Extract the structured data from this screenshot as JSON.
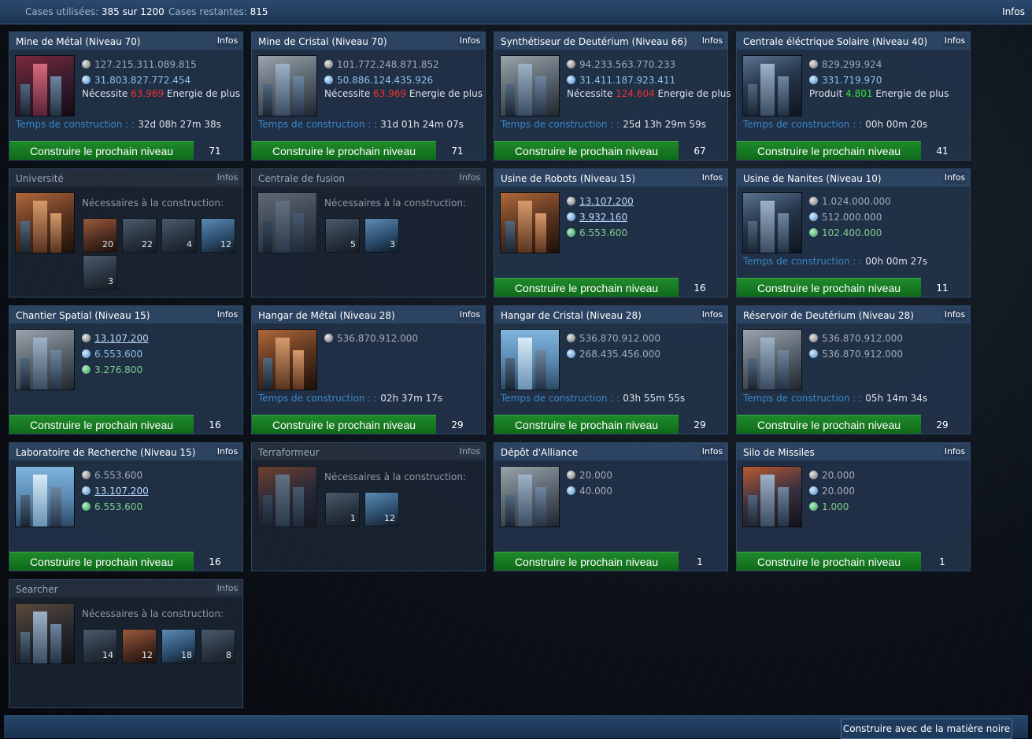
{
  "topbar": {
    "used_label": "Cases utilisées:",
    "used_value": "385 sur 1200",
    "remaining_label": "Cases restantes:",
    "remaining_value": "815",
    "info_label": "Infos"
  },
  "common": {
    "info_button": "Infos",
    "build_button": "Construire le prochain niveau",
    "time_label": "Temps de construction : :",
    "needs_label": "Nécessaires à la construction:",
    "requires_prefix": "Nécessite",
    "produces_prefix": "Produit",
    "energy_suffix": "Energie de plus"
  },
  "cards": {
    "metal_mine": {
      "title": "Mine de Métal (Niveau 70)",
      "metal": "127.215.311.089.815",
      "crystal": "31.803.827.772.454",
      "energy": "63.969",
      "time": "32d 08h 27m 38s",
      "next_level": "71"
    },
    "crystal_mine": {
      "title": "Mine de Cristal (Niveau 70)",
      "metal": "101.772.248.871.852",
      "crystal": "50.886.124.435.926",
      "energy": "63.969",
      "time": "31d 01h 24m 07s",
      "next_level": "71"
    },
    "deut_synth": {
      "title": "Synthétiseur de Deutérium (Niveau 66)",
      "metal": "94.233.563.770.233",
      "crystal": "31.411.187.923.411",
      "energy": "124.604",
      "time": "25d 13h 29m 59s",
      "next_level": "67"
    },
    "solar_plant": {
      "title": "Centrale éléctrique Solaire (Niveau 40)",
      "metal": "829.299.924",
      "crystal": "331.719.970",
      "energy": "4.801",
      "time": "00h 00m 20s",
      "next_level": "41"
    },
    "university": {
      "title": "Université",
      "reqs": [
        "20",
        "22",
        "4",
        "12",
        "3"
      ]
    },
    "fusion_plant": {
      "title": "Centrale de fusion",
      "reqs": [
        "5",
        "3"
      ]
    },
    "robot_factory": {
      "title": "Usine de Robots (Niveau 15)",
      "metal": "13.107.200",
      "crystal": "3.932.160",
      "deut": "6.553.600",
      "next_level": "16"
    },
    "nanite_factory": {
      "title": "Usine de Nanites (Niveau 10)",
      "metal": "1.024.000.000",
      "crystal": "512.000.000",
      "deut": "102.400.000",
      "time": "00h 00m 27s",
      "next_level": "11"
    },
    "shipyard": {
      "title": "Chantier Spatial (Niveau 15)",
      "metal": "13.107.200",
      "crystal": "6.553.600",
      "deut": "3.276.800",
      "next_level": "16"
    },
    "metal_storage": {
      "title": "Hangar de Métal (Niveau 28)",
      "metal": "536.870.912.000",
      "time": "02h 37m 17s",
      "next_level": "29"
    },
    "crystal_storage": {
      "title": "Hangar de Cristal (Niveau 28)",
      "metal": "536.870.912.000",
      "crystal": "268.435.456.000",
      "time": "03h 55m 55s",
      "next_level": "29"
    },
    "deut_tank": {
      "title": "Réservoir de Deutérium (Niveau 28)",
      "metal": "536.870.912.000",
      "crystal": "536.870.912.000",
      "time": "05h 14m 34s",
      "next_level": "29"
    },
    "research_lab": {
      "title": "Laboratoire de Recherche (Niveau 15)",
      "metal": "6.553.600",
      "crystal": "13.107.200",
      "deut": "6.553.600",
      "next_level": "16"
    },
    "terraformer": {
      "title": "Terraformeur",
      "reqs": [
        "1",
        "12"
      ]
    },
    "alliance_depot": {
      "title": "Dépôt d'Alliance",
      "metal": "20.000",
      "crystal": "40.000",
      "next_level": "1"
    },
    "missile_silo": {
      "title": "Silo de Missiles",
      "metal": "20.000",
      "crystal": "20.000",
      "deut": "1.000",
      "next_level": "1"
    },
    "searcher": {
      "title": "Searcher",
      "reqs": [
        "14",
        "12",
        "18",
        "8"
      ]
    }
  },
  "bottombar": {
    "dark_matter_button": "Construire avec de la matière noire"
  },
  "colors": {
    "build_button": "#1f8a2a",
    "energy_needed": "#f03030",
    "energy_produced": "#35e035",
    "time_label": "#3a88c8",
    "link": "#b9ddff"
  }
}
